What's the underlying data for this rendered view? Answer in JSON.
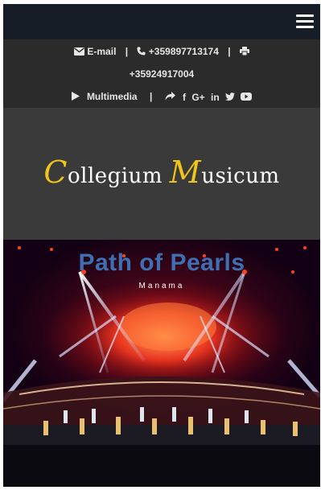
{
  "nav": {
    "menu_icon": "hamburger-menu-icon"
  },
  "contact": {
    "email_icon": "envelope-icon",
    "email_label": "E-mail",
    "phone_icon": "phone-icon",
    "phone": "+359897713174",
    "fax_icon": "printer-icon",
    "fax": "+35924917004",
    "multimedia_icon": "play-icon",
    "multimedia_label": "Multimedia",
    "share_icon": "share-icon",
    "social": {
      "facebook": "f",
      "google_plus": "G+",
      "linkedin": "in",
      "twitter_icon": "twitter-icon",
      "youtube_icon": "youtube-icon"
    },
    "separator": "|"
  },
  "logo": {
    "c_letter": "C",
    "part1": "ollegium ",
    "m_letter": "M",
    "part2": "usicum",
    "accent_color": "#f0c419"
  },
  "hero": {
    "title": "Path of Pearls",
    "subtitle": "Manama",
    "title_color": "#3e6fb3"
  }
}
